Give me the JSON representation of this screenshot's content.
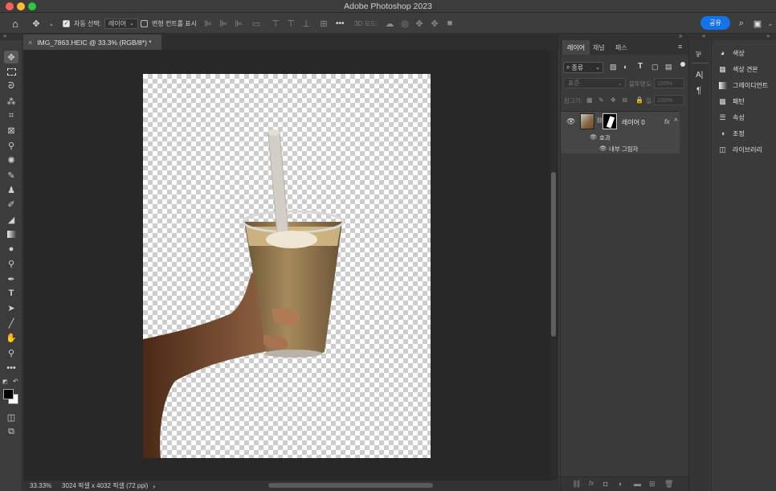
{
  "app": {
    "title": "Adobe Photoshop 2023"
  },
  "options_bar": {
    "auto_select_label": "자동 선택:",
    "auto_select_target": "레이어",
    "show_transform_label": "변형 컨트롤 표시",
    "mode_3d_label": "3D 모드:",
    "more_label": "•••",
    "share_label": "공유"
  },
  "document": {
    "tab_title": "IMG_7863.HEIC @ 33.3% (RGB/8*) *",
    "close_glyph": "×"
  },
  "status": {
    "zoom": "33.33%",
    "info": "3024 픽셀 x 4032 픽셀 (72 ppi)",
    "arrow": "›"
  },
  "layers_panel": {
    "tabs": [
      "레이어",
      "채널",
      "패스"
    ],
    "filter_kind": "종류",
    "blend_mode": "표준",
    "opacity_label": "불투명도:",
    "opacity_value": "100%",
    "lock_label": "잠그기:",
    "fill_label": "칠:",
    "fill_value": "100%",
    "layer_name": "레이어 0",
    "fx_label": "fx",
    "effects_label": "효과",
    "effect_item": "내부 그림자"
  },
  "right_panel": {
    "items": [
      "색상",
      "색상 견본",
      "그레이디언트",
      "패턴",
      "속성",
      "조정",
      "라이브러리"
    ]
  },
  "colors": {
    "share": "#1473e6",
    "close": "#ff5f57",
    "minimize": "#febc2e",
    "zoom": "#28c840",
    "foreground": "#000000",
    "background": "#ffffff"
  }
}
